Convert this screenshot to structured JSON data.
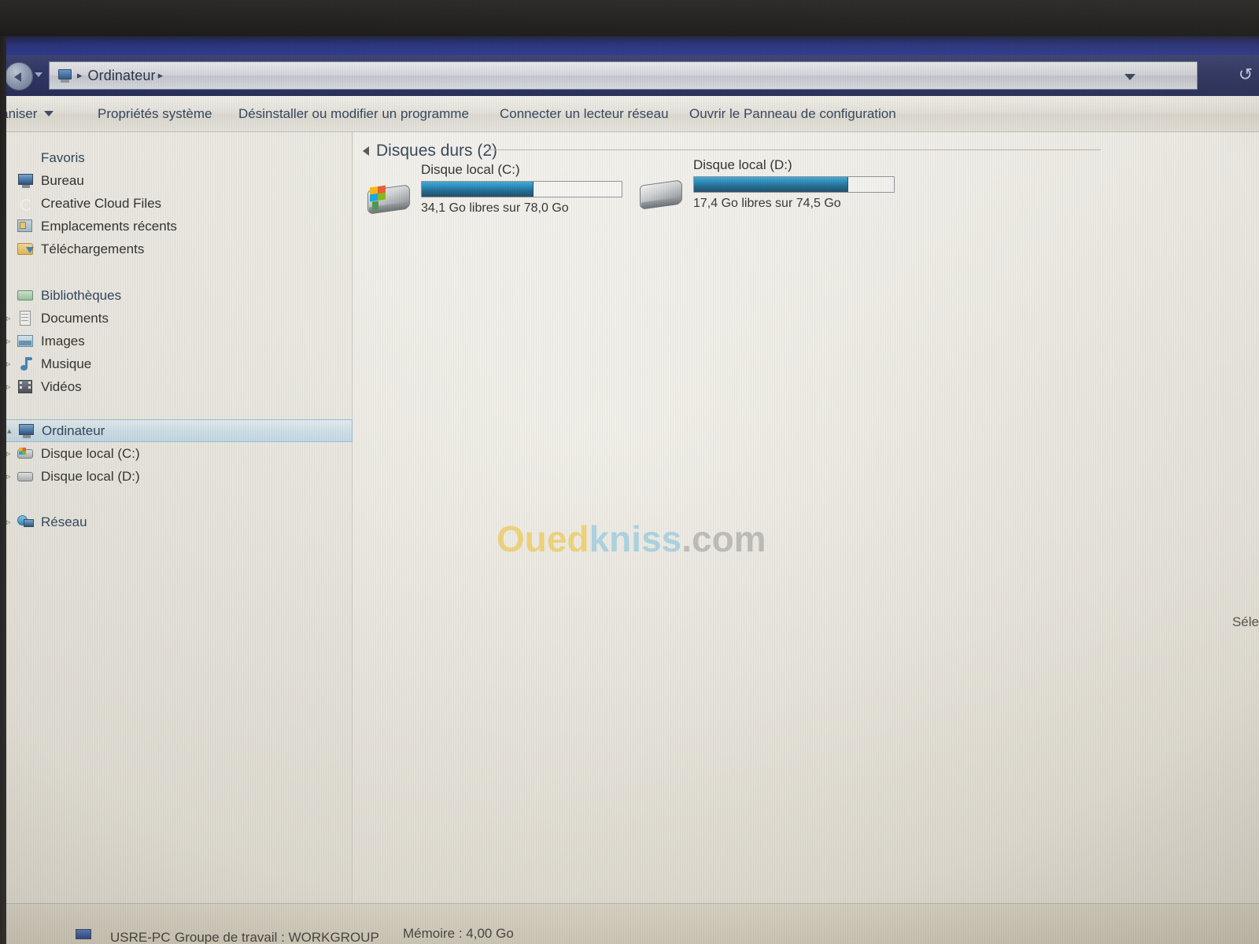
{
  "window": {
    "breadcrumb": {
      "icon": "computer-icon",
      "path_label": "Ordinateur",
      "separator": "▸",
      "trailing_separator": "▸",
      "dropdown_icon": "chevron-down-icon",
      "refresh_icon": "refresh-icon",
      "back_icon": "back-arrow-icon"
    }
  },
  "toolbar": {
    "organiser_label": "rganiser",
    "properties_label": "Propriétés système",
    "uninstall_label": "Désinstaller ou modifier un programme",
    "connect_drive_label": "Connecter un lecteur réseau",
    "control_panel_label": "Ouvrir le Panneau de configuration"
  },
  "sidebar": {
    "sections": [
      {
        "name": "favoris",
        "header": {
          "label": "Favoris",
          "icon": "star-icon"
        },
        "items": [
          {
            "label": "Bureau",
            "icon": "desktop-monitor-icon",
            "expandable": false
          },
          {
            "label": "Creative Cloud Files",
            "icon": "creative-cloud-icon",
            "expandable": false
          },
          {
            "label": "Emplacements récents",
            "icon": "recent-places-icon",
            "expandable": false
          },
          {
            "label": "Téléchargements",
            "icon": "downloads-folder-icon",
            "expandable": false
          }
        ]
      },
      {
        "name": "bibliotheques",
        "header": {
          "label": "Bibliothèques",
          "icon": "libraries-icon"
        },
        "items": [
          {
            "label": "Documents",
            "icon": "documents-icon",
            "expandable": true,
            "expander": "▹"
          },
          {
            "label": "Images",
            "icon": "pictures-icon",
            "expandable": true,
            "expander": "▹"
          },
          {
            "label": "Musique",
            "icon": "music-icon",
            "expandable": true,
            "expander": "▹"
          },
          {
            "label": "Vidéos",
            "icon": "videos-icon",
            "expandable": true,
            "expander": "▹"
          }
        ]
      },
      {
        "name": "ordinateur",
        "header": {
          "label": "Ordinateur",
          "icon": "computer-icon",
          "selected": true,
          "expander": "▴"
        },
        "items": [
          {
            "label": "Disque local (C:)",
            "icon": "hard-drive-windows-icon",
            "expandable": true,
            "expander": "▹"
          },
          {
            "label": "Disque local (D:)",
            "icon": "hard-drive-icon",
            "expandable": true,
            "expander": "▹"
          }
        ]
      },
      {
        "name": "reseau",
        "header": {
          "label": "Réseau",
          "icon": "network-icon",
          "expander": "▹"
        },
        "items": []
      }
    ]
  },
  "content": {
    "group": {
      "title": "Disques durs (2)",
      "caret_icon": "collapse-caret-icon"
    },
    "drives": [
      {
        "name": "Disque local (C:)",
        "free_text": "34,1 Go libres sur 78,0 Go",
        "free_gb": 34.1,
        "total_gb": 78.0,
        "used_percent": 56,
        "icon": "hard-drive-windows-icon"
      },
      {
        "name": "Disque local (D:)",
        "free_text": "17,4 Go libres sur 74,5 Go",
        "free_gb": 17.4,
        "total_gb": 74.5,
        "used_percent": 77,
        "icon": "hard-drive-icon"
      }
    ],
    "watermark": {
      "part1": "Oued",
      "part2": "kniss",
      "part3": ".com"
    },
    "cut_off_label": "Séle"
  },
  "statusbar": {
    "pc_name": "USRE-PC",
    "workgroup_label": "Groupe de travail : WORKGROUP",
    "memory_label": "Mémoire : 4,00 Go",
    "icon": "computer-icon"
  },
  "colors": {
    "accent_blue": "#0f7fb8",
    "selection_blue": "#c2dced",
    "titlebar_blue": "#1d2660",
    "window_bg": "#f0efea",
    "watermark_yellow": "#f5c42a",
    "watermark_blue": "#79c4e8"
  }
}
